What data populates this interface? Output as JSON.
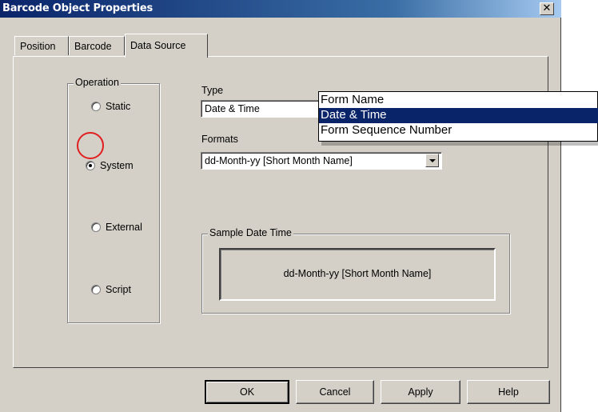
{
  "window": {
    "title": "Barcode Object Properties",
    "close_glyph": "✕"
  },
  "tabs": [
    {
      "label": "Position",
      "active": false
    },
    {
      "label": "Barcode",
      "active": false
    },
    {
      "label": "Data Source",
      "active": true
    }
  ],
  "operation": {
    "group_label": "Operation",
    "options": [
      {
        "label": "Static",
        "checked": false
      },
      {
        "label": "System",
        "checked": true
      },
      {
        "label": "External",
        "checked": false
      },
      {
        "label": "Script",
        "checked": false
      }
    ]
  },
  "type_field": {
    "label": "Type",
    "value": "Date & Time",
    "options": [
      "Form Name",
      "Date & Time",
      "Form Sequence Number"
    ],
    "selected_option": "Date & Time"
  },
  "formats_field": {
    "label": "Formats",
    "value": "dd-Month-yy [Short Month Name]"
  },
  "sample": {
    "group_label": "Sample Date Time",
    "value": "dd-Month-yy [Short Month Name]"
  },
  "buttons": {
    "ok": "OK",
    "cancel": "Cancel",
    "apply": "Apply",
    "help": "Help"
  },
  "colors": {
    "dialog_face": "#d4d0c8",
    "title_bar": "#0a246a",
    "selection": "#0a246a",
    "highlight_circle": "#e02020"
  }
}
